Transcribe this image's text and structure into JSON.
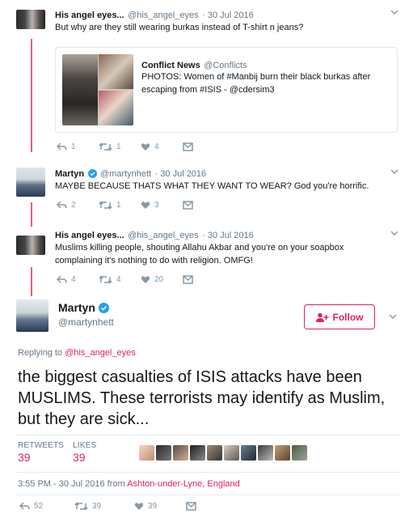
{
  "reply1": {
    "name": "His angel eyes...",
    "handle": "@his_angel_eyes",
    "date": "· 30 Jul 2016",
    "text": "But why are they still wearing burkas instead of T-shirt n jeans?",
    "quote": {
      "name": "Conflict News",
      "handle": "@Conflicts",
      "text": "PHOTOS: Women of #Manbij burn their black burkas after escaping from #ISIS - @cdersim3"
    },
    "actions": {
      "reply": "1",
      "retweet": "1",
      "like": "4"
    }
  },
  "reply2": {
    "name": "Martyn",
    "handle": "@martynhett",
    "date": "· 30 Jul 2016",
    "text": "MAYBE BECAUSE THATS WHAT THEY WANT TO WEAR? God you're horrific.",
    "actions": {
      "reply": "2",
      "retweet": "1",
      "like": "3"
    }
  },
  "reply3": {
    "name": "His angel eyes...",
    "handle": "@his_angel_eyes",
    "date": "· 30 Jul 2016",
    "text_line1": "Muslims killing people, shouting Allahu Akbar and you're on your soapbox",
    "text_line2": "complaining it's nothing to do with religion. OMFG!",
    "actions": {
      "reply": "4",
      "retweet": "4",
      "like": "20"
    }
  },
  "main": {
    "name": "Martyn",
    "handle": "@martynhett",
    "follow_label": "Follow",
    "replying_prefix": "Replying to",
    "replying_to": "@his_angel_eyes",
    "text": "the biggest casualties of ISIS attacks have been MUSLIMS. These terrorists may identify as Muslim, but they are sick...",
    "retweets_label": "RETWEETS",
    "retweets": "39",
    "likes_label": "LIKES",
    "likes": "39",
    "time": "3:55 PM - 30 Jul 2016 from",
    "location": "Ashton-under-Lyne, England",
    "actions": {
      "reply": "52",
      "retweet": "39",
      "like": "39"
    }
  },
  "colors": {
    "accent": "#e0245e",
    "muted": "#8899a6",
    "text": "#14171a"
  },
  "icons": [
    "reply-icon",
    "retweet-icon",
    "heart-icon",
    "dm-icon",
    "verified-icon",
    "follow-person-icon",
    "chevron-down-icon"
  ]
}
